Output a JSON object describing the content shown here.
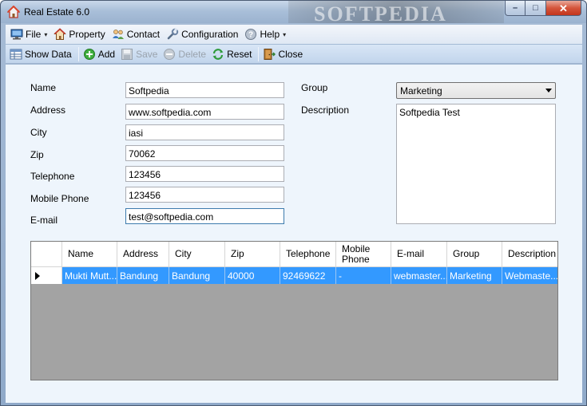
{
  "window": {
    "title": "Real Estate 6.0",
    "watermark": "SOFTPEDIA",
    "minimize_symbol": "–",
    "maximize_symbol": "□",
    "close_symbol": "✕"
  },
  "menu": {
    "items": [
      {
        "label": "File",
        "icon": "monitor-icon",
        "has_caret": true
      },
      {
        "label": "Property",
        "icon": "house-icon",
        "has_caret": false
      },
      {
        "label": "Contact",
        "icon": "contacts-icon",
        "has_caret": false
      },
      {
        "label": "Configuration",
        "icon": "wrench-icon",
        "has_caret": false
      },
      {
        "label": "Help",
        "icon": "help-icon",
        "has_caret": true
      }
    ],
    "caret": "▾"
  },
  "toolbar": {
    "show_data": "Show Data",
    "add": "Add",
    "save": "Save",
    "delete": "Delete",
    "reset": "Reset",
    "close": "Close"
  },
  "form": {
    "labels": {
      "name": "Name",
      "address": "Address",
      "city": "City",
      "zip": "Zip",
      "telephone": "Telephone",
      "mobile_phone": "Mobile Phone",
      "email": "E-mail",
      "group": "Group",
      "description": "Description"
    },
    "values": {
      "name": "Softpedia",
      "address": "www.softpedia.com",
      "city": "iasi",
      "zip": "70062",
      "telephone": "123456",
      "mobile_phone": "123456",
      "email": "test@softpedia.com",
      "group": "Marketing",
      "description": "Softpedia Test"
    }
  },
  "grid": {
    "columns": [
      "Name",
      "Address",
      "City",
      "Zip",
      "Telephone",
      "Mobile Phone",
      "E-mail",
      "Group",
      "Description"
    ],
    "rows": [
      [
        "Mukti Mutt...",
        "Bandung",
        "Bandung",
        "40000",
        "92469622",
        "-",
        "webmaster...",
        "Marketing",
        "Webmaste..."
      ]
    ]
  },
  "colors": {
    "selection": "#3399ff",
    "grid_background": "#a3a3a3",
    "client_background": "#eef5fc"
  }
}
